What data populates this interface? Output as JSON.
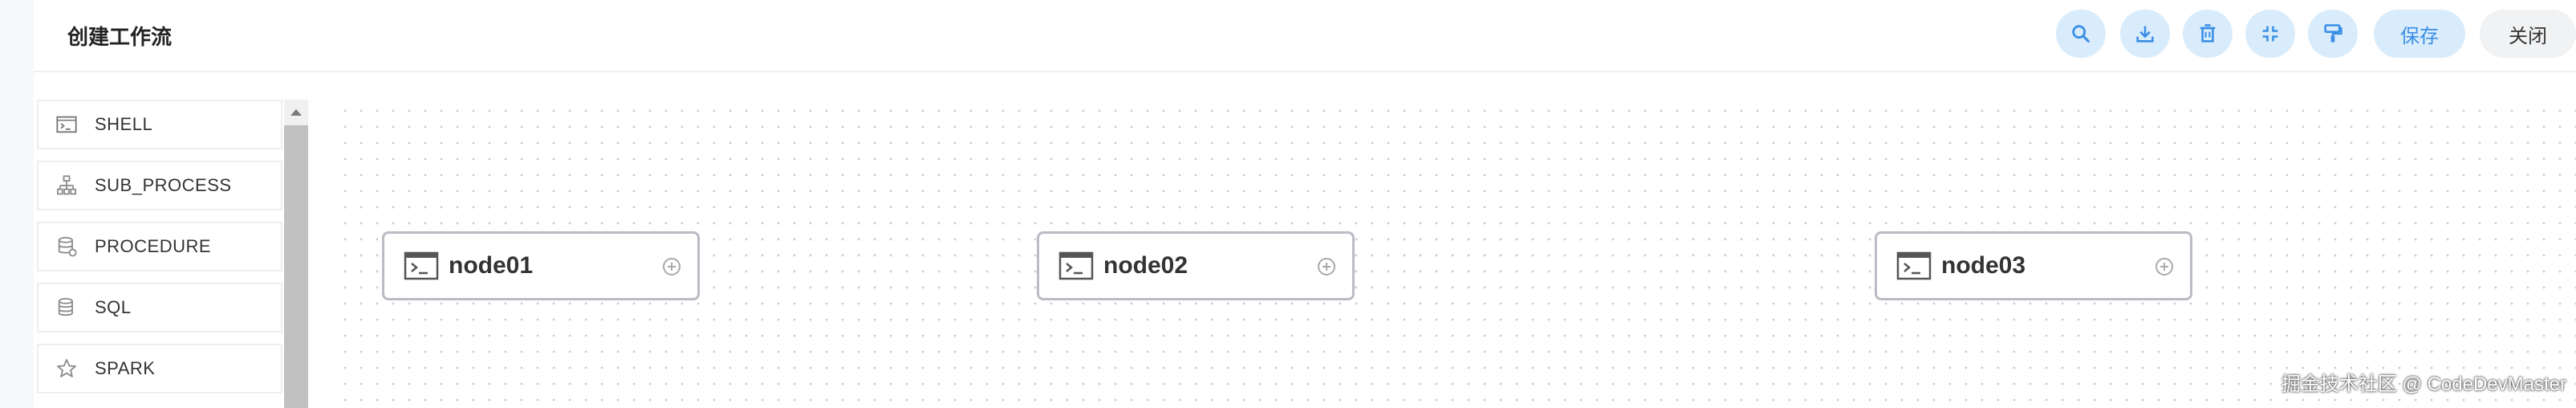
{
  "header": {
    "title": "创建工作流",
    "save_label": "保存",
    "close_label": "关闭"
  },
  "toolbar_icons": [
    "search-icon",
    "download-icon",
    "delete-icon",
    "fullscreen-icon",
    "format-brush-icon"
  ],
  "sidebar": {
    "items": [
      {
        "label": "SHELL",
        "icon": "terminal-icon"
      },
      {
        "label": "SUB_PROCESS",
        "icon": "subprocess-icon"
      },
      {
        "label": "PROCEDURE",
        "icon": "procedure-icon"
      },
      {
        "label": "SQL",
        "icon": "database-icon"
      },
      {
        "label": "SPARK",
        "icon": "star-icon"
      }
    ]
  },
  "canvas": {
    "nodes": [
      {
        "label": "node01",
        "icon": "terminal-icon"
      },
      {
        "label": "node02",
        "icon": "terminal-icon"
      },
      {
        "label": "node03",
        "icon": "terminal-icon"
      }
    ]
  },
  "watermark": "掘金技术社区 @ CodeDevMaster",
  "colors": {
    "accent": "#3a8ee6",
    "accent_bg": "#d9ecfb",
    "node_border": "#b9bcc2"
  }
}
